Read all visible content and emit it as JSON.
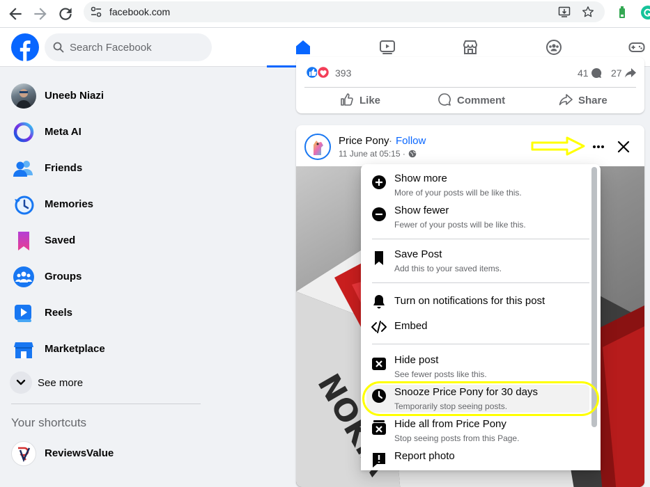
{
  "browser": {
    "url": "facebook.com",
    "icons": [
      "back-arrow-icon",
      "forward-arrow-icon",
      "reload-icon",
      "site-settings-icon",
      "install-app-icon",
      "star-icon",
      "extension-icon",
      "grammarly-icon"
    ]
  },
  "topbar": {
    "search_placeholder": "Search Facebook",
    "tabs": [
      "home",
      "video",
      "marketplace",
      "groups",
      "gaming"
    ],
    "accent": "#0866ff"
  },
  "sidebar": {
    "items": [
      {
        "label": "Uneeb Niazi",
        "icon": "avatar"
      },
      {
        "label": "Meta AI",
        "icon": "meta-ai-icon"
      },
      {
        "label": "Friends",
        "icon": "friends-icon"
      },
      {
        "label": "Memories",
        "icon": "memories-icon"
      },
      {
        "label": "Saved",
        "icon": "saved-icon"
      },
      {
        "label": "Groups",
        "icon": "groups-icon"
      },
      {
        "label": "Reels",
        "icon": "reels-icon"
      },
      {
        "label": "Marketplace",
        "icon": "marketplace-icon"
      }
    ],
    "see_more": "See more",
    "shortcuts_title": "Your shortcuts",
    "shortcuts": [
      {
        "label": "ReviewsValue"
      }
    ]
  },
  "post1": {
    "reactions_count": "393",
    "comments_count": "41",
    "shares_count": "27",
    "actions": {
      "like": "Like",
      "comment": "Comment",
      "share": "Share"
    }
  },
  "post2": {
    "page_name": "Price Pony",
    "separator": " · ",
    "follow": "Follow",
    "timestamp": "11 June at 05:15 ·"
  },
  "menu": {
    "items": [
      {
        "title": "Show more",
        "subtitle": "More of your posts will be like this.",
        "icon": "plus-circle-icon"
      },
      {
        "title": "Show fewer",
        "subtitle": "Fewer of your posts will be like this.",
        "icon": "minus-circle-icon"
      },
      {
        "title": "Save Post",
        "subtitle": "Add this to your saved items.",
        "icon": "bookmark-icon"
      },
      {
        "title": "Turn on notifications for this post",
        "subtitle": "",
        "icon": "bell-icon"
      },
      {
        "title": "Embed",
        "subtitle": "",
        "icon": "code-icon"
      },
      {
        "title": "Hide post",
        "subtitle": "See fewer posts like this.",
        "icon": "hide-post-icon"
      },
      {
        "title": "Snooze Price Pony for 30 days",
        "subtitle": "Temporarily stop seeing posts.",
        "icon": "clock-icon"
      },
      {
        "title": "Hide all from Price Pony",
        "subtitle": "Stop seeing posts from this Page.",
        "icon": "hide-all-icon"
      },
      {
        "title": "Report photo",
        "subtitle": "",
        "icon": "report-icon"
      }
    ],
    "highlighted_index": 6
  },
  "annotation": {
    "color": "#ffff00"
  }
}
